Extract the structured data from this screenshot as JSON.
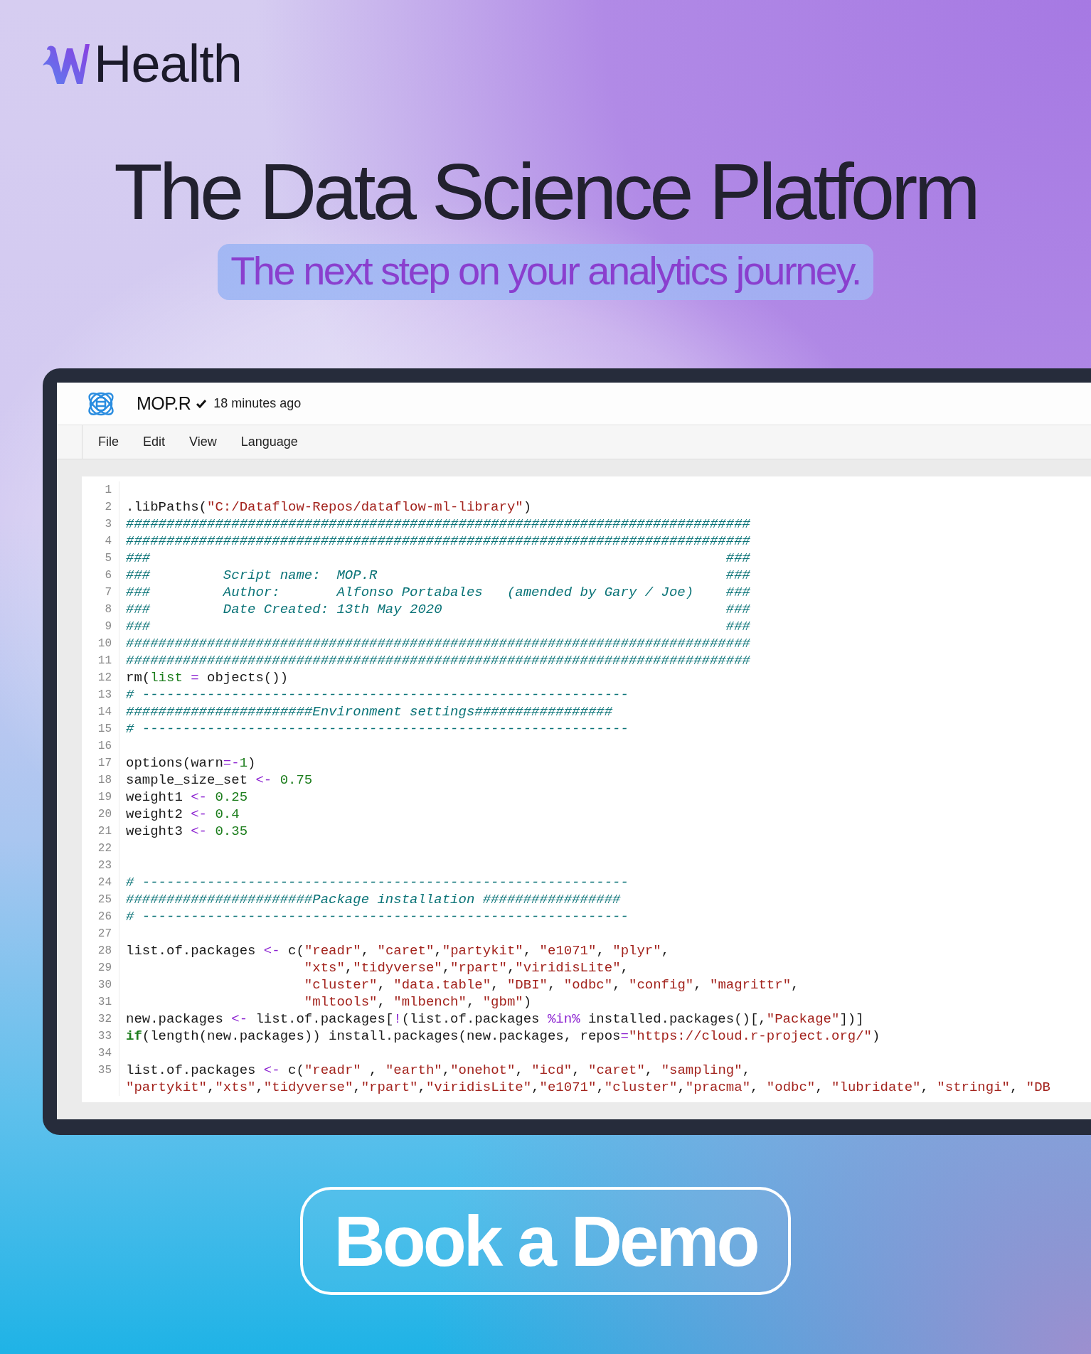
{
  "brand": {
    "name": "Health"
  },
  "headline": "The Data Science Platform",
  "tagline": "The next step on your analytics journey.",
  "editor": {
    "file_name": "MOP.R",
    "saved": true,
    "saved_time": "18 minutes ago",
    "menu": [
      "File",
      "Edit",
      "View",
      "Language"
    ],
    "lines": [
      {
        "number": "1"
      },
      {
        "number": "2",
        "tokens": [
          {
            "kind": "plain",
            "text": ".libPaths("
          },
          {
            "kind": "string",
            "text": "\"C:/Dataflow-Repos/dataflow-ml-library\""
          },
          {
            "kind": "plain",
            "text": ")"
          }
        ]
      },
      {
        "number": "3",
        "tokens": [
          {
            "kind": "comment",
            "text": "#############################################################################"
          }
        ]
      },
      {
        "number": "4",
        "tokens": [
          {
            "kind": "comment",
            "text": "#############################################################################"
          }
        ]
      },
      {
        "number": "5",
        "tokens": [
          {
            "kind": "comment",
            "text": "###                                                                       ###"
          }
        ]
      },
      {
        "number": "6",
        "tokens": [
          {
            "kind": "comment",
            "text": "###         Script name:  MOP.R                                           ###"
          }
        ]
      },
      {
        "number": "7",
        "tokens": [
          {
            "kind": "comment",
            "text": "###         Author:       Alfonso Portabales   (amended by Gary / Joe)    ###"
          }
        ]
      },
      {
        "number": "8",
        "tokens": [
          {
            "kind": "comment",
            "text": "###         Date Created: 13th May 2020                                   ###"
          }
        ]
      },
      {
        "number": "9",
        "tokens": [
          {
            "kind": "comment",
            "text": "###                                                                       ###"
          }
        ]
      },
      {
        "number": "10",
        "tokens": [
          {
            "kind": "comment",
            "text": "#############################################################################"
          }
        ]
      },
      {
        "number": "11",
        "tokens": [
          {
            "kind": "comment",
            "text": "#############################################################################"
          }
        ]
      },
      {
        "number": "12",
        "tokens": [
          {
            "kind": "plain",
            "text": "rm("
          },
          {
            "kind": "param",
            "text": "list"
          },
          {
            "kind": "operator",
            "text": " = "
          },
          {
            "kind": "plain",
            "text": "objects())"
          }
        ]
      },
      {
        "number": "13",
        "tokens": [
          {
            "kind": "comment",
            "text": "# ------------------------------------------------------------"
          }
        ]
      },
      {
        "number": "14",
        "tokens": [
          {
            "kind": "comment",
            "text": "#######################Environment settings#################"
          }
        ]
      },
      {
        "number": "15",
        "tokens": [
          {
            "kind": "comment",
            "text": "# ------------------------------------------------------------"
          }
        ]
      },
      {
        "number": "16"
      },
      {
        "number": "17",
        "tokens": [
          {
            "kind": "plain",
            "text": "options(warn"
          },
          {
            "kind": "operator",
            "text": "=-"
          },
          {
            "kind": "number",
            "text": "1"
          },
          {
            "kind": "plain",
            "text": ")"
          }
        ]
      },
      {
        "number": "18",
        "tokens": [
          {
            "kind": "plain",
            "text": "sample_size_set "
          },
          {
            "kind": "operator",
            "text": "<- "
          },
          {
            "kind": "number",
            "text": "0.75"
          }
        ]
      },
      {
        "number": "19",
        "tokens": [
          {
            "kind": "plain",
            "text": "weight1 "
          },
          {
            "kind": "operator",
            "text": "<- "
          },
          {
            "kind": "number",
            "text": "0.25"
          }
        ]
      },
      {
        "number": "20",
        "tokens": [
          {
            "kind": "plain",
            "text": "weight2 "
          },
          {
            "kind": "operator",
            "text": "<- "
          },
          {
            "kind": "number",
            "text": "0.4"
          }
        ]
      },
      {
        "number": "21",
        "tokens": [
          {
            "kind": "plain",
            "text": "weight3 "
          },
          {
            "kind": "operator",
            "text": "<- "
          },
          {
            "kind": "number",
            "text": "0.35"
          }
        ]
      },
      {
        "number": "22"
      },
      {
        "number": "23"
      },
      {
        "number": "24",
        "tokens": [
          {
            "kind": "comment",
            "text": "# ------------------------------------------------------------"
          }
        ]
      },
      {
        "number": "25",
        "tokens": [
          {
            "kind": "comment",
            "text": "#######################Package installation #################"
          }
        ]
      },
      {
        "number": "26",
        "tokens": [
          {
            "kind": "comment",
            "text": "# ------------------------------------------------------------"
          }
        ]
      },
      {
        "number": "27"
      },
      {
        "number": "28",
        "tokens": [
          {
            "kind": "plain",
            "text": "list.of.packages "
          },
          {
            "kind": "operator",
            "text": "<-"
          },
          {
            "kind": "plain",
            "text": " c("
          },
          {
            "kind": "string",
            "text": "\"readr\""
          },
          {
            "kind": "plain",
            "text": ", "
          },
          {
            "kind": "string",
            "text": "\"caret\""
          },
          {
            "kind": "plain",
            "text": ","
          },
          {
            "kind": "string",
            "text": "\"partykit\""
          },
          {
            "kind": "plain",
            "text": ", "
          },
          {
            "kind": "string",
            "text": "\"e1071\""
          },
          {
            "kind": "plain",
            "text": ", "
          },
          {
            "kind": "string",
            "text": "\"plyr\""
          },
          {
            "kind": "plain",
            "text": ","
          }
        ]
      },
      {
        "number": "29",
        "tokens": [
          {
            "kind": "string",
            "text": "                      \"xts\""
          },
          {
            "kind": "plain",
            "text": ","
          },
          {
            "kind": "string",
            "text": "\"tidyverse\""
          },
          {
            "kind": "plain",
            "text": ","
          },
          {
            "kind": "string",
            "text": "\"rpart\""
          },
          {
            "kind": "plain",
            "text": ","
          },
          {
            "kind": "string",
            "text": "\"viridisLite\""
          },
          {
            "kind": "plain",
            "text": ","
          }
        ]
      },
      {
        "number": "30",
        "tokens": [
          {
            "kind": "string",
            "text": "                      \"cluster\""
          },
          {
            "kind": "plain",
            "text": ", "
          },
          {
            "kind": "string",
            "text": "\"data.table\""
          },
          {
            "kind": "plain",
            "text": ", "
          },
          {
            "kind": "string",
            "text": "\"DBI\""
          },
          {
            "kind": "plain",
            "text": ", "
          },
          {
            "kind": "string",
            "text": "\"odbc\""
          },
          {
            "kind": "plain",
            "text": ", "
          },
          {
            "kind": "string",
            "text": "\"config\""
          },
          {
            "kind": "plain",
            "text": ", "
          },
          {
            "kind": "string",
            "text": "\"magrittr\""
          },
          {
            "kind": "plain",
            "text": ","
          }
        ]
      },
      {
        "number": "31",
        "tokens": [
          {
            "kind": "string",
            "text": "                      \"mltools\""
          },
          {
            "kind": "plain",
            "text": ", "
          },
          {
            "kind": "string",
            "text": "\"mlbench\""
          },
          {
            "kind": "plain",
            "text": ", "
          },
          {
            "kind": "string",
            "text": "\"gbm\""
          },
          {
            "kind": "plain",
            "text": ")"
          }
        ]
      },
      {
        "number": "32",
        "tokens": [
          {
            "kind": "plain",
            "text": "new.packages "
          },
          {
            "kind": "operator",
            "text": "<-"
          },
          {
            "kind": "plain",
            "text": " list.of.packages["
          },
          {
            "kind": "operator",
            "text": "!"
          },
          {
            "kind": "plain",
            "text": "(list.of.packages "
          },
          {
            "kind": "operator",
            "text": "%in%"
          },
          {
            "kind": "plain",
            "text": " installed.packages()[,"
          },
          {
            "kind": "string",
            "text": "\"Package\""
          },
          {
            "kind": "plain",
            "text": "])]"
          }
        ]
      },
      {
        "number": "33",
        "tokens": [
          {
            "kind": "keyword",
            "text": "if"
          },
          {
            "kind": "plain",
            "text": "(length(new.packages)) install.packages(new.packages, repos"
          },
          {
            "kind": "operator",
            "text": "="
          },
          {
            "kind": "string",
            "text": "\"https://cloud.r-project.org/\""
          },
          {
            "kind": "plain",
            "text": ")"
          }
        ]
      },
      {
        "number": "34"
      },
      {
        "number": "35",
        "tokens": [
          {
            "kind": "plain",
            "text": "list.of.packages "
          },
          {
            "kind": "operator",
            "text": "<-"
          },
          {
            "kind": "plain",
            "text": " c("
          },
          {
            "kind": "string",
            "text": "\"readr\""
          },
          {
            "kind": "plain",
            "text": " , "
          },
          {
            "kind": "string",
            "text": "\"earth\""
          },
          {
            "kind": "plain",
            "text": ","
          },
          {
            "kind": "string",
            "text": "\"onehot\""
          },
          {
            "kind": "plain",
            "text": ", "
          },
          {
            "kind": "string",
            "text": "\"icd\""
          },
          {
            "kind": "plain",
            "text": ", "
          },
          {
            "kind": "string",
            "text": "\"caret\""
          },
          {
            "kind": "plain",
            "text": ", "
          },
          {
            "kind": "string",
            "text": "\"sampling\""
          },
          {
            "kind": "plain",
            "text": ","
          }
        ]
      },
      {
        "tokens": [
          {
            "kind": "string",
            "text": "\"partykit\""
          },
          {
            "kind": "plain",
            "text": ","
          },
          {
            "kind": "string",
            "text": "\"xts\""
          },
          {
            "kind": "plain",
            "text": ","
          },
          {
            "kind": "string",
            "text": "\"tidyverse\""
          },
          {
            "kind": "plain",
            "text": ","
          },
          {
            "kind": "string",
            "text": "\"rpart\""
          },
          {
            "kind": "plain",
            "text": ","
          },
          {
            "kind": "string",
            "text": "\"viridisLite\""
          },
          {
            "kind": "plain",
            "text": ","
          },
          {
            "kind": "string",
            "text": "\"e1071\""
          },
          {
            "kind": "plain",
            "text": ","
          },
          {
            "kind": "string",
            "text": "\"cluster\""
          },
          {
            "kind": "plain",
            "text": ","
          },
          {
            "kind": "string",
            "text": "\"pracma\""
          },
          {
            "kind": "plain",
            "text": ", "
          },
          {
            "kind": "string",
            "text": "\"odbc\""
          },
          {
            "kind": "plain",
            "text": ", "
          },
          {
            "kind": "string",
            "text": "\"lubridate\""
          },
          {
            "kind": "plain",
            "text": ", "
          },
          {
            "kind": "string",
            "text": "\"stringi\""
          },
          {
            "kind": "plain",
            "text": ", "
          },
          {
            "kind": "string",
            "text": "\"DB"
          }
        ]
      }
    ]
  },
  "cta": {
    "label": "Book a Demo"
  }
}
